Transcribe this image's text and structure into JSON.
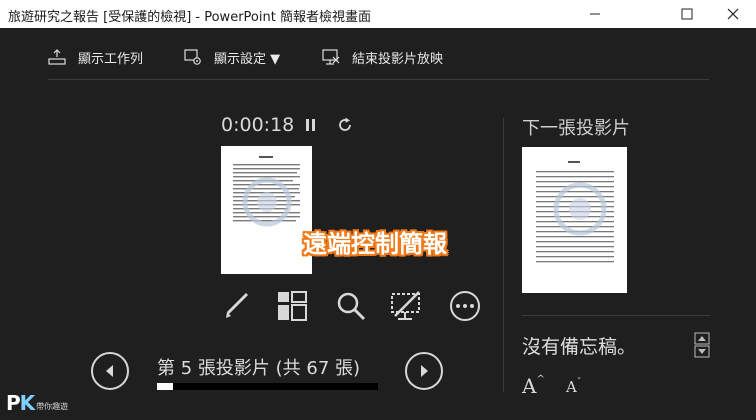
{
  "window": {
    "title": "旅遊研究之報告 [受保護的檢視] - PowerPoint 簡報者檢視畫面"
  },
  "toolbar": {
    "show_taskbar": "顯示工作列",
    "display_settings": "顯示設定 ▼",
    "end_slideshow": "結束投影片放映"
  },
  "presenter": {
    "timer": "0:00:18",
    "overlay_text": "遠端控制簡報",
    "slide_counter": "第 5 張投影片 (共 67 張)",
    "progress_fraction": 0.0746
  },
  "next_panel": {
    "label": "下一張投影片"
  },
  "notes": {
    "text": "沒有備忘稿。",
    "increase_font_label": "A",
    "decrease_font_label": "A"
  },
  "watermark": {
    "brand_p": "P",
    "brand_k": "K",
    "tagline": "帶你趣遊"
  },
  "colors": {
    "background": "#1f1f1f",
    "titlebar": "#ffffff",
    "overlay_outline": "#f07a1a"
  }
}
